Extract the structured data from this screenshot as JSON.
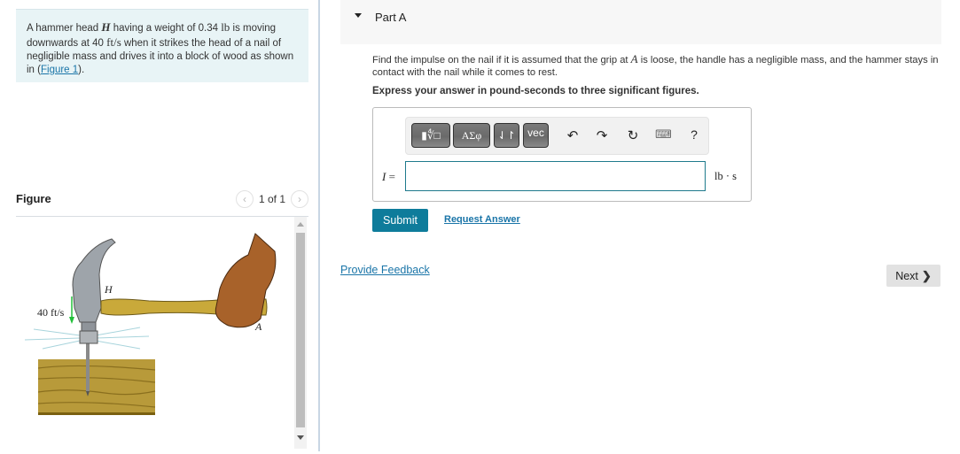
{
  "problem": {
    "text_1": "A hammer head ",
    "var_H": "H",
    "text_2": " having a weight of 0.34 ",
    "unit_lb": "lb",
    "text_3": " is moving downwards at 40 ",
    "unit_fts": "ft/s",
    "text_4": " when it strikes the head of a nail of negligible mass and drives it into a block of wood as shown in (",
    "figure_link": "Figure 1",
    "text_5": ")."
  },
  "figure_panel": {
    "title": "Figure",
    "pager_text": "1 of 1",
    "prev_icon": "‹",
    "next_icon": "›",
    "labels": {
      "velocity": "40 ft/s",
      "hammer": "H",
      "grip": "A"
    }
  },
  "part": {
    "label": "Part A",
    "question_1": "Find the impulse on the nail if it is assumed that the grip at ",
    "var_A": "A",
    "question_2": " is loose, the handle has a negligible mass, and the hammer stays in contact with the nail while it comes to rest.",
    "instruction": "Express your answer in pound-seconds to three significant figures."
  },
  "toolbar": {
    "templates_label": "▮∜□",
    "greek_label": "ΑΣφ",
    "arrows_label": "⇃↾",
    "vec_label": "vec",
    "undo_icon": "↶",
    "redo_icon": "↷",
    "reset_icon": "↻",
    "keyboard_icon": "⌨",
    "help_label": "?"
  },
  "answer": {
    "var_label": "I",
    "equals": " =",
    "value": "",
    "unit": "lb · s"
  },
  "actions": {
    "submit": "Submit",
    "request_answer": "Request Answer",
    "provide_feedback": "Provide Feedback",
    "next": "Next",
    "next_icon": "❯"
  }
}
